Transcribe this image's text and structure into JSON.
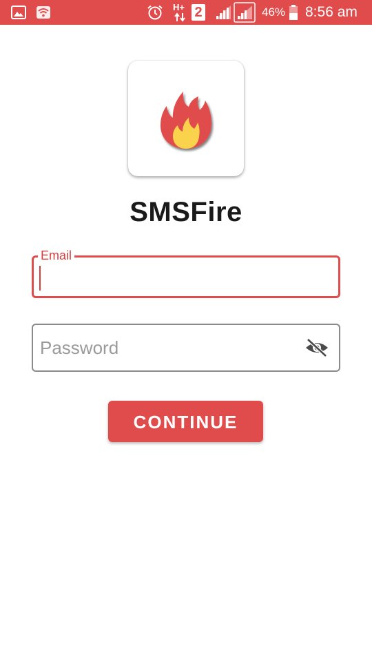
{
  "status_bar": {
    "battery": "46%",
    "time": "8:56 am",
    "network": "H+",
    "sim_slot": "2",
    "icons": [
      "gallery-icon",
      "wifi-icon",
      "alarm-icon",
      "data-arrows-icon",
      "sim-2-icon",
      "signal-icon",
      "signal-icon-2",
      "battery-icon"
    ]
  },
  "app": {
    "name": "SMSFire",
    "logo_icon": "fire-icon"
  },
  "form": {
    "email": {
      "label": "Email",
      "value": ""
    },
    "password": {
      "placeholder": "Password",
      "value": "",
      "toggle_icon": "eye-off-icon"
    },
    "continue_label": "CONTINUE"
  },
  "colors": {
    "accent": "#e04b4b",
    "flame_outer": "#e04b4b",
    "flame_inner": "#fbd24b"
  }
}
